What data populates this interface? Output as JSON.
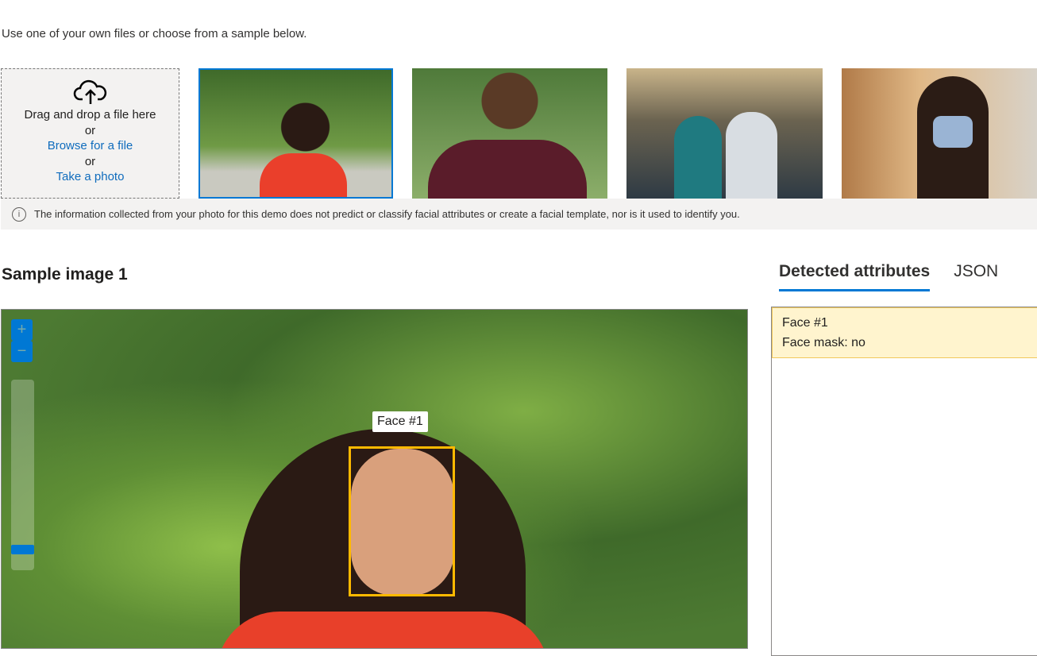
{
  "intro": "Use one of your own files or choose from a sample below.",
  "upload": {
    "drag_text": "Drag and drop a file here",
    "or1": "or",
    "browse_link": "Browse for a file",
    "or2": "or",
    "photo_link": "Take a photo",
    "icon": "cloud-upload-icon"
  },
  "samples": [
    {
      "selected": true
    },
    {
      "selected": false
    },
    {
      "selected": false
    },
    {
      "selected": false
    }
  ],
  "notice": {
    "icon": "info-icon",
    "text": "The information collected from your photo for this demo does not predict or classify facial attributes or create a facial template, nor is it used to identify you."
  },
  "viewer": {
    "title": "Sample image 1",
    "zoom_in": "+",
    "zoom_out": "−",
    "face_label": "Face #1"
  },
  "tabs": [
    {
      "label": "Detected attributes",
      "active": true
    },
    {
      "label": "JSON"
    }
  ],
  "results": [
    {
      "face": "Face #1",
      "mask": "Face mask: no"
    }
  ],
  "colors": {
    "accent": "#0078d4",
    "face_box": "#ffb900",
    "highlight": "#fff4ce"
  }
}
